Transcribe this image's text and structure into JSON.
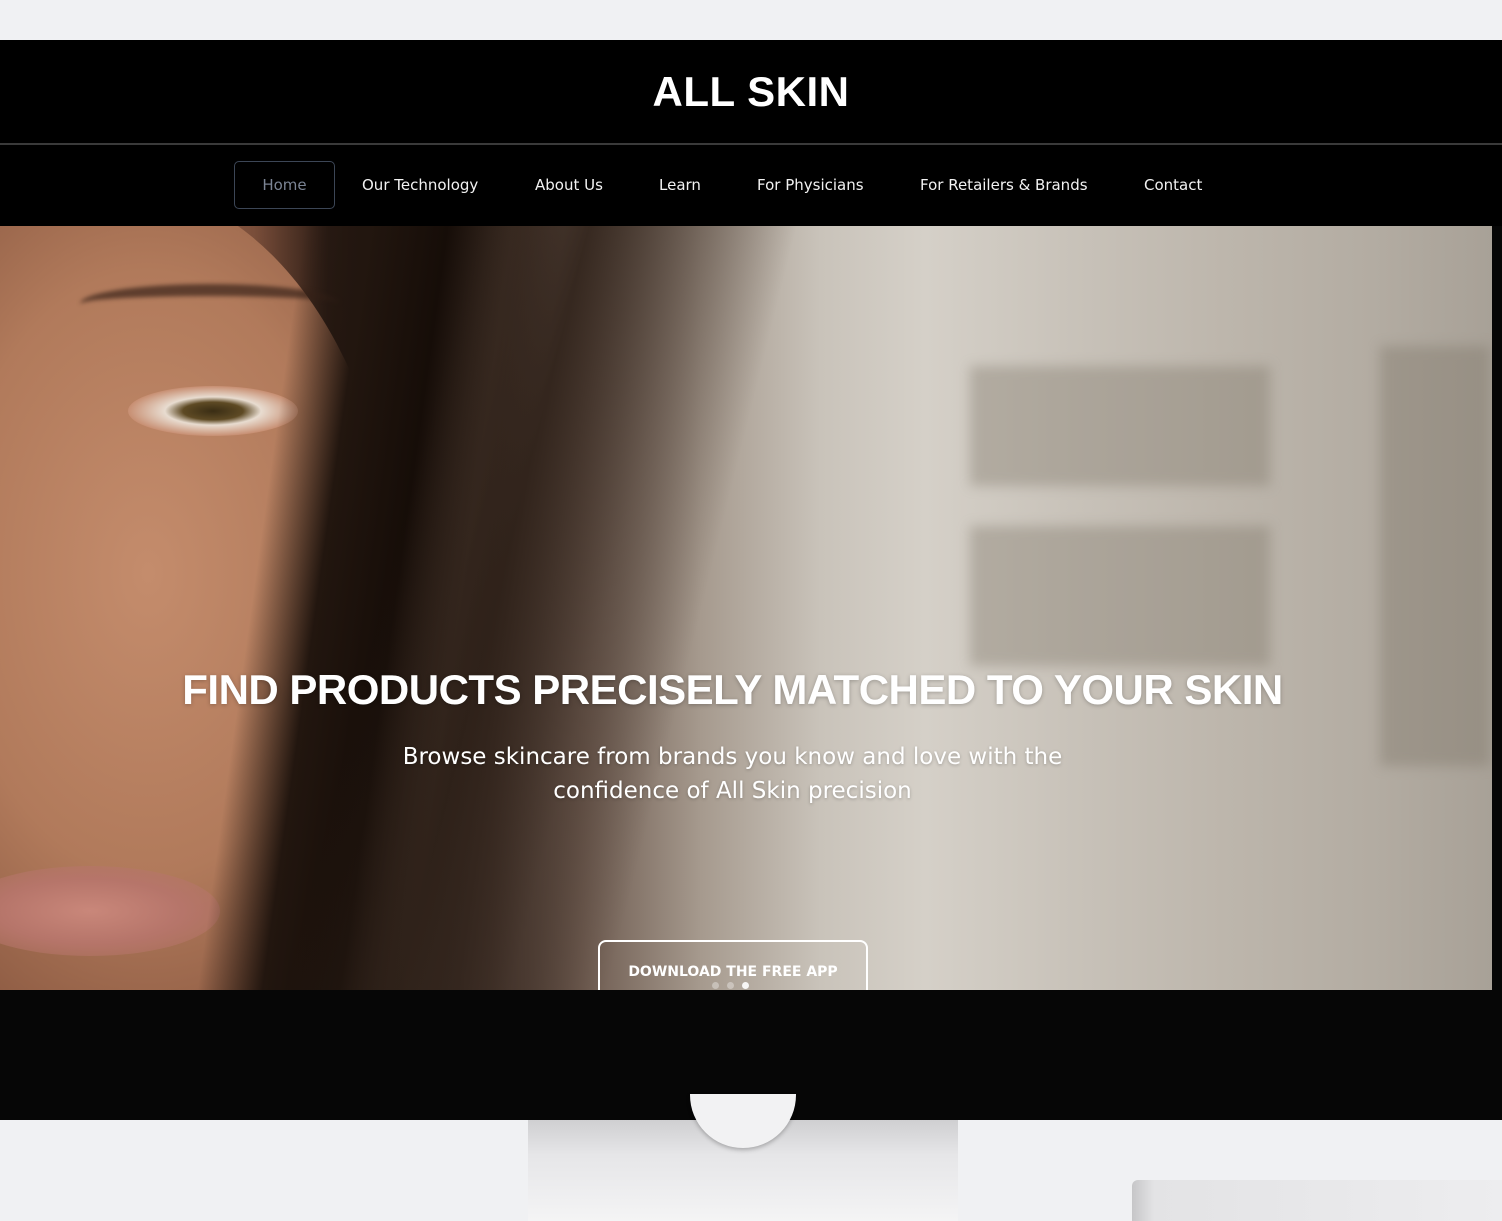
{
  "site": {
    "brand": "ALL SKIN"
  },
  "nav": {
    "items": [
      {
        "label": "Home",
        "active": true
      },
      {
        "label": "Our Technology",
        "active": false
      },
      {
        "label": "About Us",
        "active": false
      },
      {
        "label": "Learn",
        "active": false
      },
      {
        "label": "For Physicians",
        "active": false
      },
      {
        "label": "For Retailers & Brands",
        "active": false
      },
      {
        "label": "Contact",
        "active": false
      }
    ]
  },
  "hero": {
    "headline": "FIND PRODUCTS PRECISELY MATCHED TO YOUR SKIN",
    "subtext": "Browse skincare from brands you know and love with the confidence of All Skin precision",
    "cta_label": "DOWNLOAD THE FREE APP",
    "slides": {
      "count": 3,
      "active_index": 2
    }
  },
  "colors": {
    "background": "#f0f1f3",
    "header_bg": "#000000",
    "text_primary": "#ffffff",
    "nav_active_border": "#3c4656",
    "nav_active_text": "#7b8494"
  }
}
